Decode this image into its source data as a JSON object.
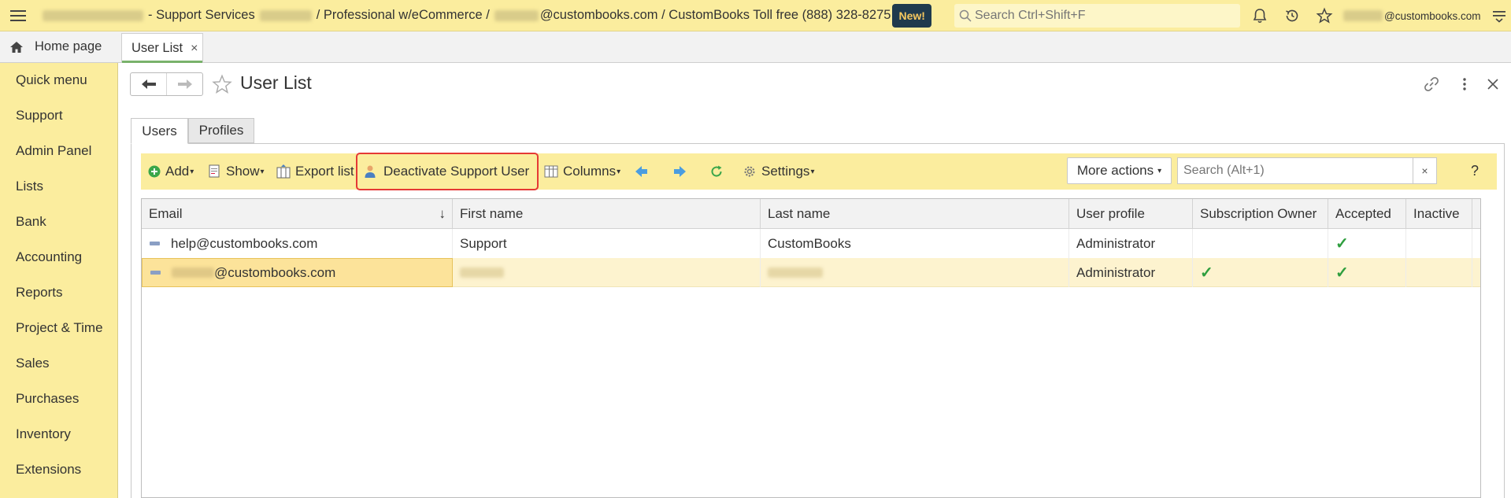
{
  "topbar": {
    "title_part1": "- Support Services",
    "title_part2": "/ Professional w/eCommerce /",
    "title_part3": "@custombooks.com / CustomBooks Toll free (888) 328-8275",
    "new_badge": "New!",
    "search_placeholder": "Search Ctrl+Shift+F",
    "user_suffix": "@custombooks.com"
  },
  "tabs": {
    "home": "Home page",
    "user_list": "User List",
    "close_glyph": "×"
  },
  "sidebar": {
    "items": [
      "Quick menu",
      "Support",
      "Admin Panel",
      "Lists",
      "Bank",
      "Accounting",
      "Reports",
      "Project & Time",
      "Sales",
      "Purchases",
      "Inventory",
      "Extensions"
    ]
  },
  "page": {
    "title": "User List",
    "form_tabs": [
      "Users",
      "Profiles"
    ]
  },
  "toolbar": {
    "add": "Add",
    "show": "Show",
    "export": "Export list",
    "deactivate": "Deactivate Support User",
    "columns": "Columns",
    "settings": "Settings",
    "more_actions": "More actions",
    "search_placeholder": "Search (Alt+1)",
    "clear": "×",
    "help": "?"
  },
  "table": {
    "columns": [
      "Email",
      "First name",
      "Last name",
      "User profile",
      "Subscription Owner",
      "Accepted",
      "Inactive"
    ],
    "sort_indicator": "↓",
    "rows": [
      {
        "email": "help@custombooks.com",
        "first_name": "Support",
        "last_name": "CustomBooks",
        "profile": "Administrator",
        "subscription_owner": false,
        "accepted": true,
        "inactive": false
      },
      {
        "email": "@custombooks.com",
        "first_name": "",
        "last_name": "",
        "profile": "Administrator",
        "subscription_owner": true,
        "accepted": true,
        "inactive": false
      }
    ],
    "check_glyph": "✓"
  },
  "colors": {
    "accent_yellow": "#fbed9e",
    "highlight_red": "#e53935",
    "check_green": "#2e9e3e",
    "badge_bg": "#1f3a4d"
  }
}
